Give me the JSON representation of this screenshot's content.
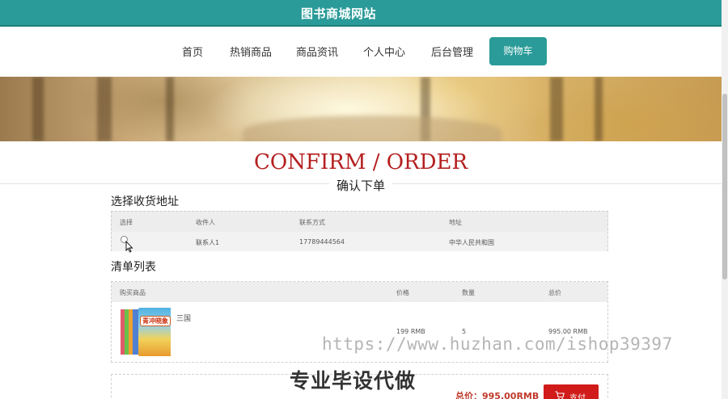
{
  "header": {
    "site_title": "图书商城网站"
  },
  "nav": {
    "items": [
      {
        "label": "首页"
      },
      {
        "label": "热销商品"
      },
      {
        "label": "商品资讯"
      },
      {
        "label": "个人中心"
      },
      {
        "label": "后台管理"
      }
    ],
    "active": {
      "label": "购物车"
    }
  },
  "hero": {
    "title_en": "CONFIRM / ORDER",
    "title_cn": "确认下单"
  },
  "address": {
    "section_title": "选择收货地址",
    "columns": [
      "选择",
      "收件人",
      "联系方式",
      "地址"
    ],
    "rows": [
      {
        "recipient": "联系人1",
        "phone": "17789444564",
        "address": "中华人民共和国"
      }
    ]
  },
  "order_list": {
    "section_title": "清单列表",
    "columns": [
      "购买商品",
      "价格",
      "数量",
      "总价"
    ],
    "rows": [
      {
        "name": "三国",
        "price": "199 RMB",
        "quantity": "5",
        "total": "995.00 RMB",
        "cover_label": "青冲晓象"
      }
    ]
  },
  "summary": {
    "total_label": "总价：995.00RMB",
    "pay_label": "支付"
  },
  "watermark": {
    "url": "https://www.huzhan.com/ishop39397",
    "slogan": "专业毕设代做"
  },
  "colors": {
    "primary": "#2a9b98",
    "hero_red": "#b51f1f",
    "pay_red": "#d11a1a"
  },
  "icons": {
    "cart": "cart-icon",
    "cursor": "mouse-cursor-icon",
    "radio": "radio-button"
  }
}
